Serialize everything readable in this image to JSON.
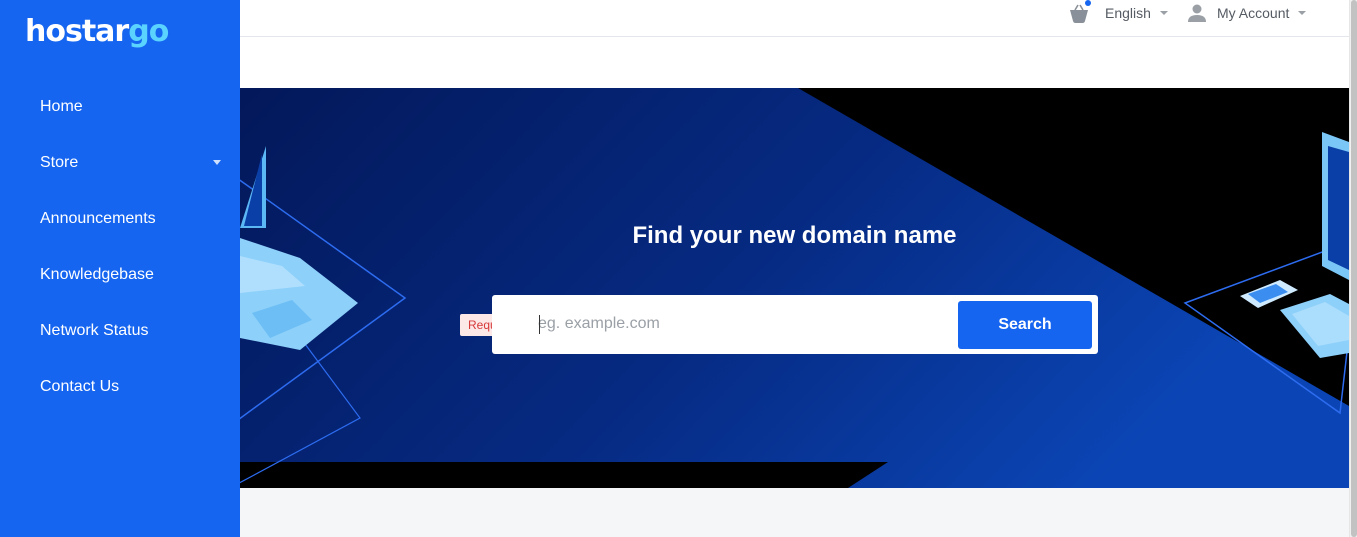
{
  "brand": {
    "logo_text_main": "hostar",
    "logo_text_accent": "go"
  },
  "sidebar": {
    "items": [
      {
        "label": "Home"
      },
      {
        "label": "Store",
        "has_dropdown": true
      },
      {
        "label": "Announcements"
      },
      {
        "label": "Knowledgebase"
      },
      {
        "label": "Network Status"
      },
      {
        "label": "Contact Us"
      }
    ]
  },
  "topbar": {
    "cart_icon": "basket-icon",
    "cart_has_notification": true,
    "language": "English",
    "account": "My Account"
  },
  "hero": {
    "title": "Find your new domain name",
    "search_placeholder": "eg. example.com",
    "search_value": "",
    "search_button": "Search",
    "validation_message": "Required"
  },
  "colors": {
    "sidebar": "#1565f0",
    "accent": "#1565f0",
    "hero_dark": "#041d5c",
    "hero_mid": "#0b3fa8",
    "logo_accent": "#5ad3ff",
    "error": "#d63a3a"
  }
}
